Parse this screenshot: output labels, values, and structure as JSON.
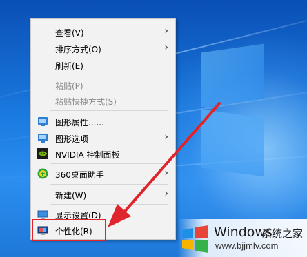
{
  "colors": {
    "desktop": "#1a7ae0",
    "menu_bg": "#f2f2f2",
    "highlight": "#e0242b",
    "arrow": "#e0242b"
  },
  "menu": {
    "items": [
      {
        "label": "查看(V)",
        "icon": "",
        "submenu": true,
        "disabled": false
      },
      {
        "label": "排序方式(O)",
        "icon": "",
        "submenu": true,
        "disabled": false
      },
      {
        "label": "刷新(E)",
        "icon": "",
        "submenu": false,
        "disabled": false
      },
      {
        "label": "粘贴(P)",
        "icon": "",
        "submenu": false,
        "disabled": true
      },
      {
        "label": "粘贴快捷方式(S)",
        "icon": "",
        "submenu": false,
        "disabled": true
      },
      {
        "label": "图形属性......",
        "icon": "intel-graphics-icon",
        "submenu": false,
        "disabled": false
      },
      {
        "label": "图形选项",
        "icon": "intel-graphics-icon",
        "submenu": true,
        "disabled": false
      },
      {
        "label": "NVIDIA 控制面板",
        "icon": "nvidia-icon",
        "submenu": false,
        "disabled": false
      },
      {
        "label": "360桌面助手",
        "icon": "360-icon",
        "submenu": true,
        "disabled": false
      },
      {
        "label": "新建(W)",
        "icon": "",
        "submenu": true,
        "disabled": false
      },
      {
        "label": "显示设置(D)",
        "icon": "display-settings-icon",
        "submenu": false,
        "disabled": false
      },
      {
        "label": "个性化(R)",
        "icon": "personalize-icon",
        "submenu": false,
        "disabled": false
      }
    ],
    "submenu_glyph": "›"
  },
  "watermark": {
    "title": "Windows",
    "cn": "系统之家",
    "url": "www.bjjmlv.com"
  }
}
